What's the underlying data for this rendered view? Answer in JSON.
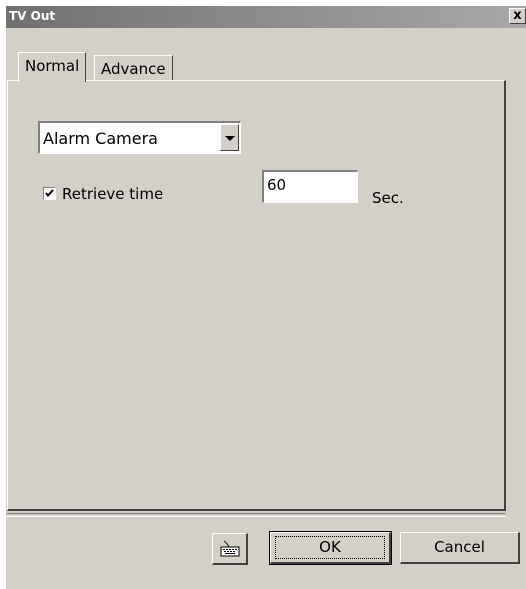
{
  "window": {
    "title": "TV Out",
    "close_label": "x"
  },
  "tabs": [
    {
      "label": "Normal",
      "active": true
    },
    {
      "label": "Advance",
      "active": false
    }
  ],
  "camera_select": {
    "value": "Alarm Camera"
  },
  "retrieve": {
    "checked": true,
    "label": "Retrieve time",
    "value": "60",
    "unit": "Sec."
  },
  "buttons": {
    "keyboard_icon": "keyboard-icon",
    "ok": "OK",
    "cancel": "Cancel"
  }
}
